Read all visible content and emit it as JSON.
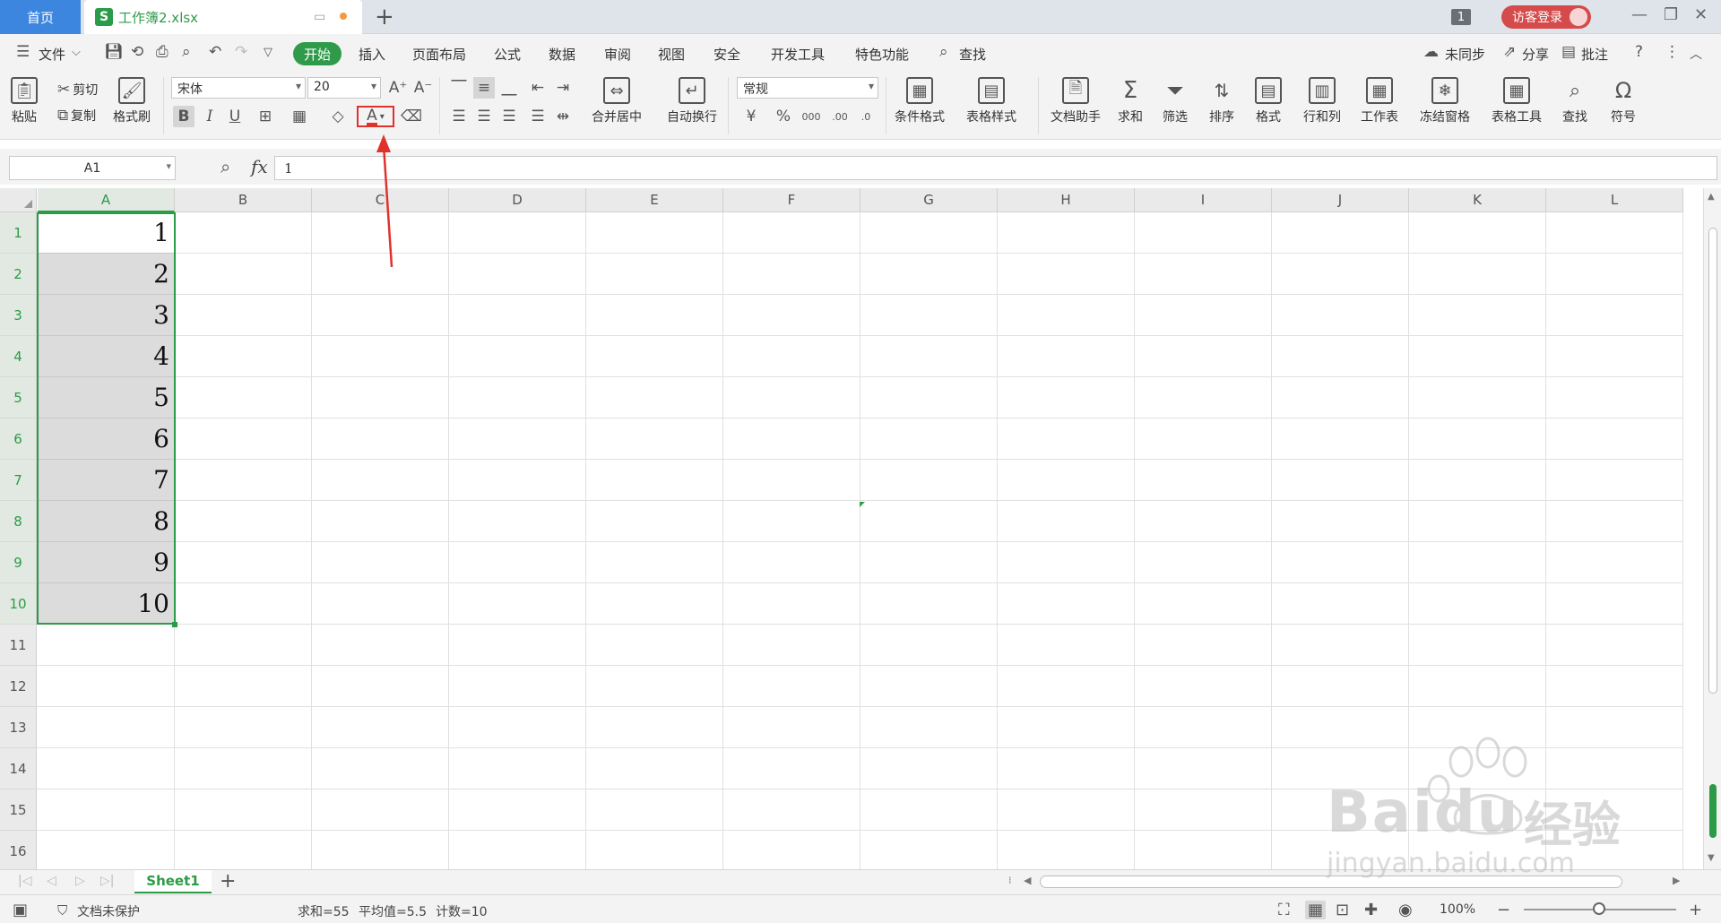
{
  "titlebar": {
    "home_tab": "首页",
    "doc_tab": "工作簿2.xlsx",
    "doc_icon": "S",
    "new_tab": "+",
    "window_badge": "1",
    "login": "访客登录"
  },
  "menu": {
    "file": "文件",
    "tabs": [
      "开始",
      "插入",
      "页面布局",
      "公式",
      "数据",
      "审阅",
      "视图",
      "安全",
      "开发工具",
      "特色功能"
    ],
    "search": "查找",
    "sync": "未同步",
    "share": "分享",
    "comment": "批注"
  },
  "ribbon": {
    "paste": "粘贴",
    "cut": "剪切",
    "copy": "复制",
    "format_painter": "格式刷",
    "font_name": "宋体",
    "font_size": "20",
    "merge_center": "合并居中",
    "wrap_text": "自动换行",
    "number_format": "常规",
    "conditional_format": "条件格式",
    "table_style": "表格样式",
    "doc_helper": "文档助手",
    "sum": "求和",
    "filter": "筛选",
    "sort": "排序",
    "format": "格式",
    "rows_cols": "行和列",
    "worksheet": "工作表",
    "freeze": "冻结窗格",
    "table_tools": "表格工具",
    "find": "查找",
    "symbol": "符号"
  },
  "formula_bar": {
    "name_box": "A1",
    "fx": "fx",
    "value": "1"
  },
  "columns": [
    "A",
    "B",
    "C",
    "D",
    "E",
    "F",
    "G",
    "H",
    "I",
    "J",
    "K",
    "L"
  ],
  "rows": [
    "1",
    "2",
    "3",
    "4",
    "5",
    "6",
    "7",
    "8",
    "9",
    "10",
    "11",
    "12",
    "13",
    "14",
    "15",
    "16"
  ],
  "cells_A": [
    "1",
    "2",
    "3",
    "4",
    "5",
    "6",
    "7",
    "8",
    "9",
    "10"
  ],
  "sheet": {
    "tab": "Sheet1",
    "add": "+"
  },
  "status": {
    "protect": "文档未保护",
    "sum": "求和=55",
    "avg": "平均值=5.5",
    "count": "计数=10",
    "zoom": "100%"
  },
  "watermark": {
    "brand": "Baidu",
    "brand_cn": "经验",
    "url": "jingyan.baidu.com"
  },
  "colors": {
    "accent_green": "#2c9b45",
    "home_blue": "#3d86e0",
    "login_red": "#d54a4a",
    "annotation_red": "#e0322d"
  }
}
